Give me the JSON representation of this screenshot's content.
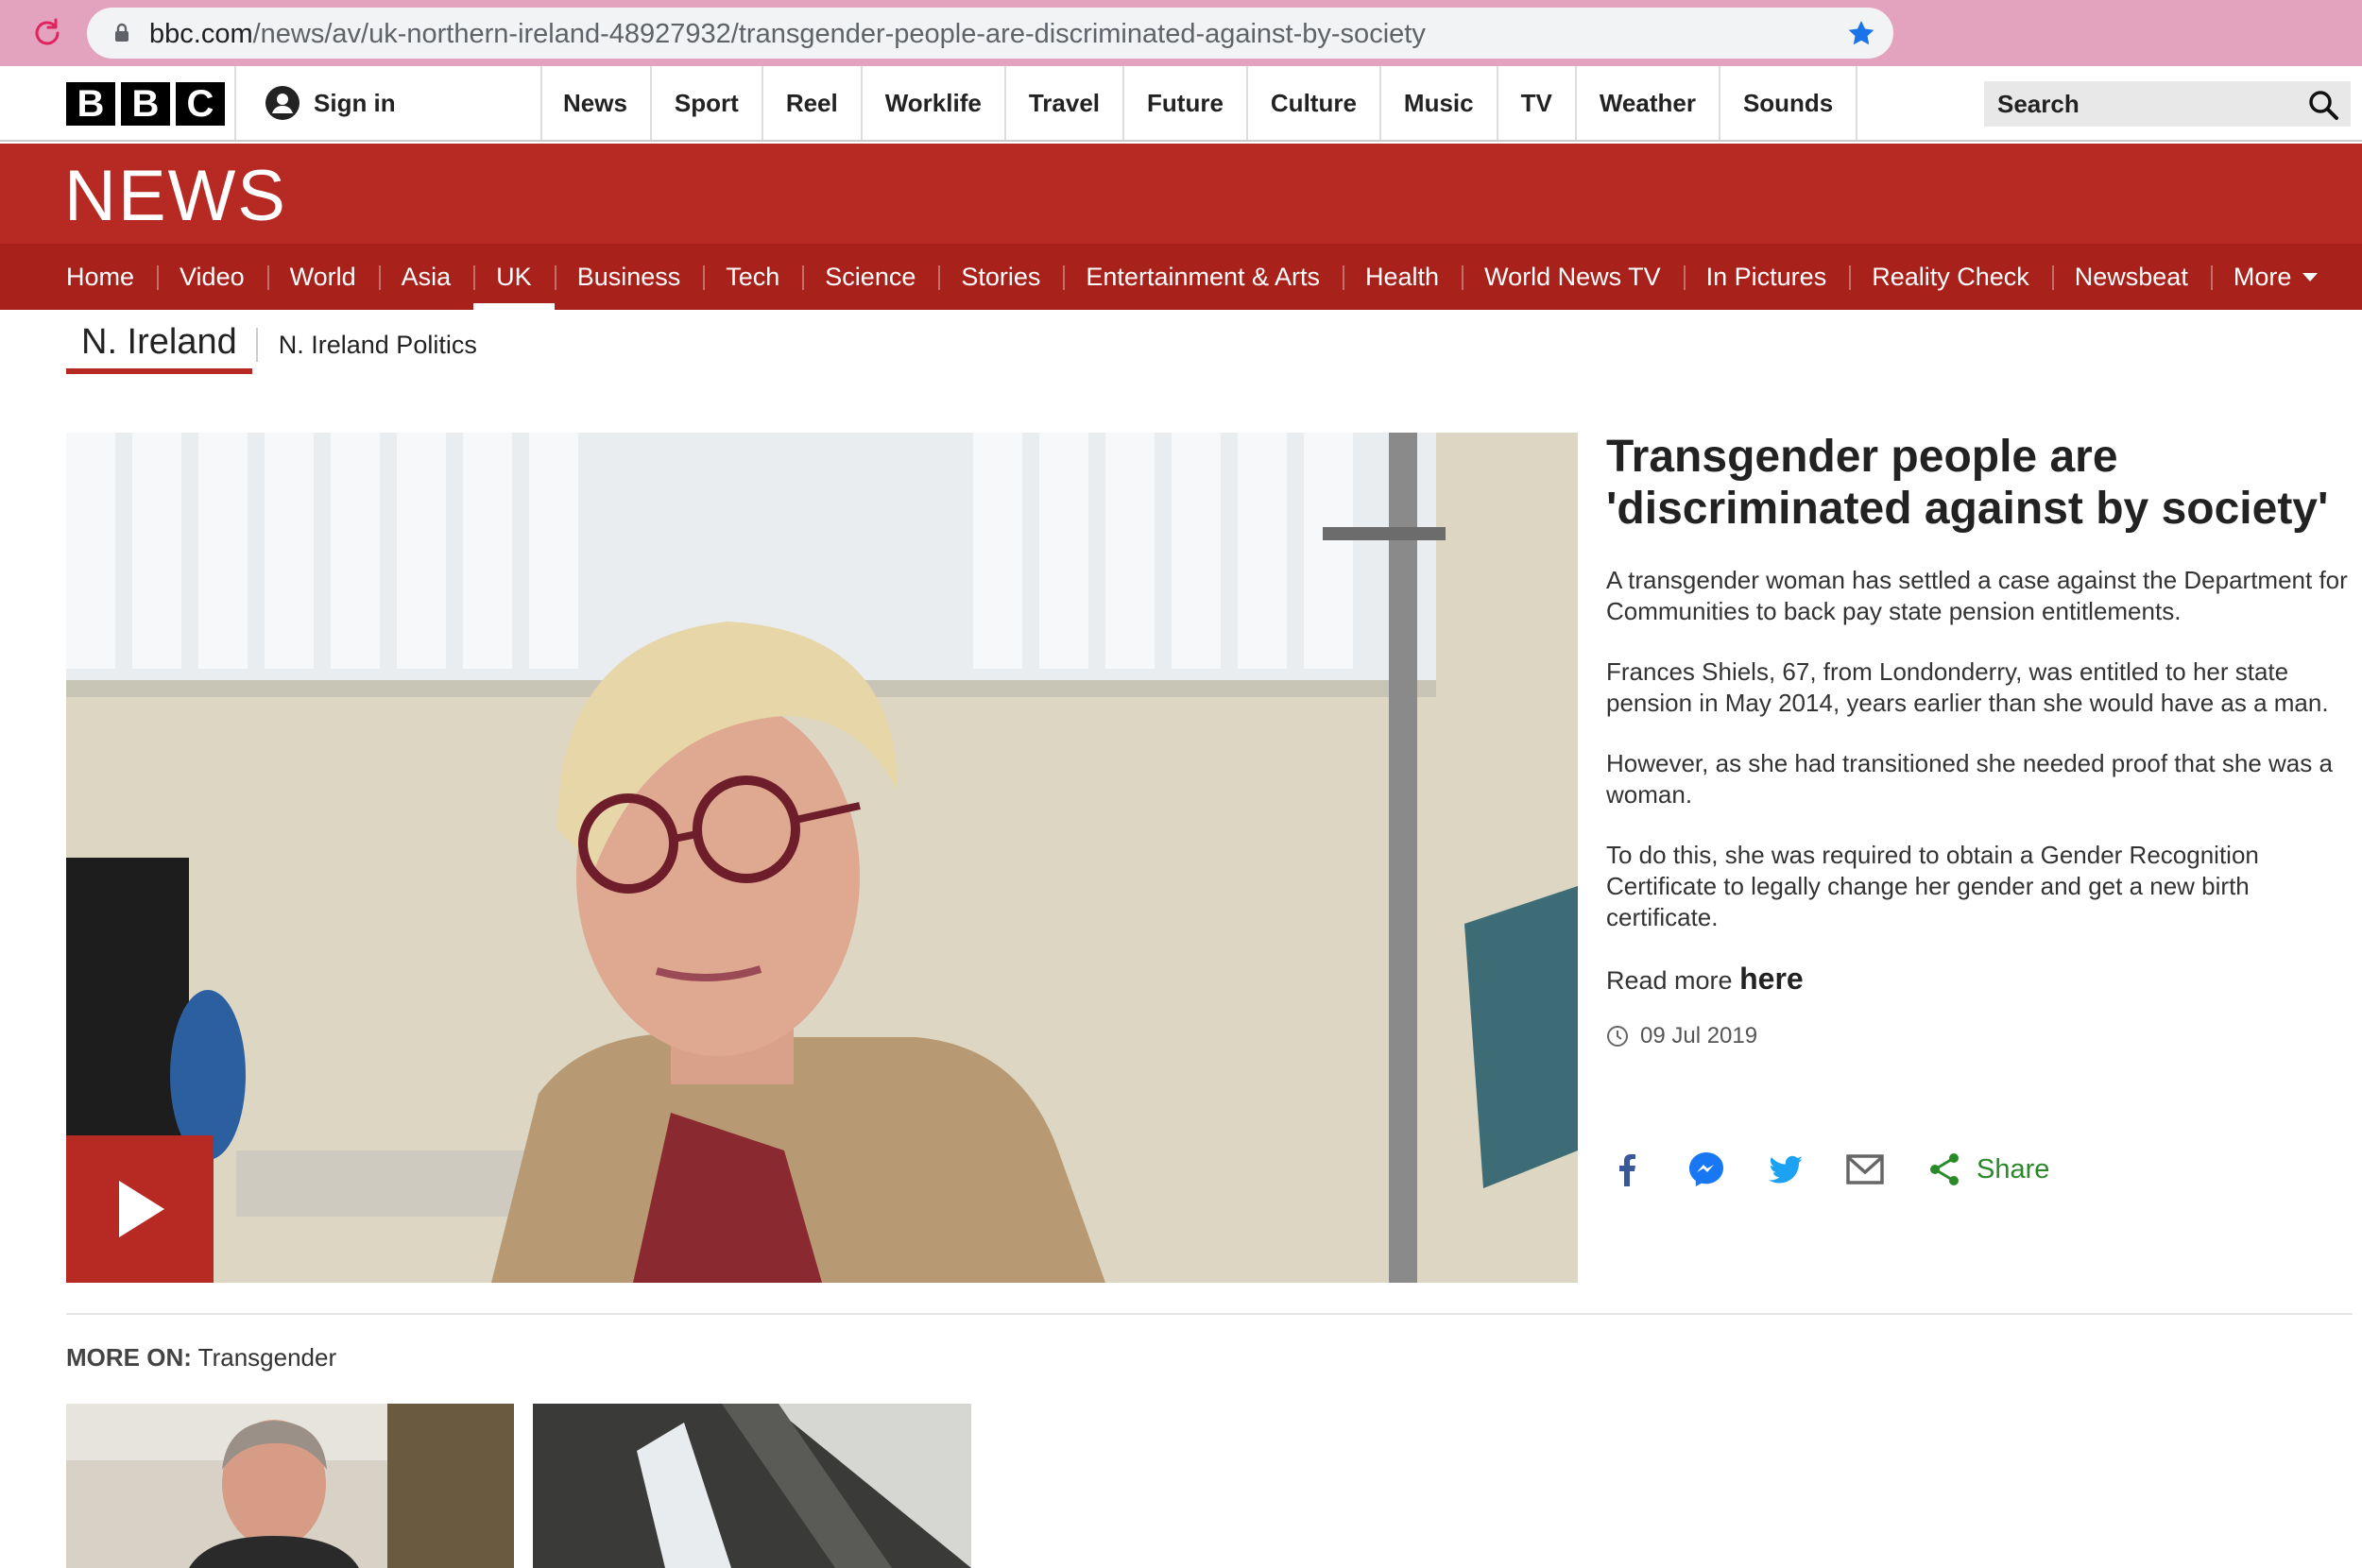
{
  "browser": {
    "url_host": "bbc.com",
    "url_path": "/news/av/uk-northern-ireland-48927932/transgender-people-are-discriminated-against-by-society"
  },
  "masthead": {
    "logo_letters": [
      "B",
      "B",
      "C"
    ],
    "signin_label": "Sign in",
    "nav": [
      "News",
      "Sport",
      "Reel",
      "Worklife",
      "Travel",
      "Future",
      "Culture",
      "Music",
      "TV",
      "Weather",
      "Sounds"
    ],
    "search_placeholder": "Search"
  },
  "banner": {
    "title": "NEWS"
  },
  "section_nav": {
    "items": [
      "Home",
      "Video",
      "World",
      "Asia",
      "UK",
      "Business",
      "Tech",
      "Science",
      "Stories",
      "Entertainment & Arts",
      "Health",
      "World News TV",
      "In Pictures",
      "Reality Check",
      "Newsbeat",
      "More"
    ],
    "active": "UK"
  },
  "sub_nav": {
    "primary": "N. Ireland",
    "secondary": "N. Ireland Politics"
  },
  "article": {
    "headline": "Transgender people are 'discriminated against by society'",
    "paragraphs": [
      "A transgender woman has settled a case against the Department for Communities to back pay state pension entitlements.",
      "Frances Shiels, 67, from Londonderry, was entitled to her state pension in May 2014, years earlier than she would have as a man.",
      "However, as she had transitioned she needed proof that she was a woman.",
      "To do this, she was required to obtain a Gender Recognition Certificate to legally change her gender and get a new birth certificate."
    ],
    "read_more_prefix": "Read more",
    "read_more_link": "here",
    "date": "09 Jul 2019",
    "share_label": "Share"
  },
  "more_on": {
    "label": "MORE ON:",
    "topic": "Transgender"
  },
  "colors": {
    "bbc_red": "#b62a23",
    "nav_red": "#a8211b",
    "share_green": "#2a8a2a",
    "facebook": "#3b5998",
    "messenger": "#1877f2",
    "twitter": "#1da1f2"
  },
  "icons": [
    "reload-icon",
    "lock-icon",
    "star-icon",
    "person-icon",
    "search-icon",
    "play-icon",
    "clock-icon",
    "facebook-icon",
    "messenger-icon",
    "twitter-icon",
    "email-icon",
    "share-icon"
  ]
}
